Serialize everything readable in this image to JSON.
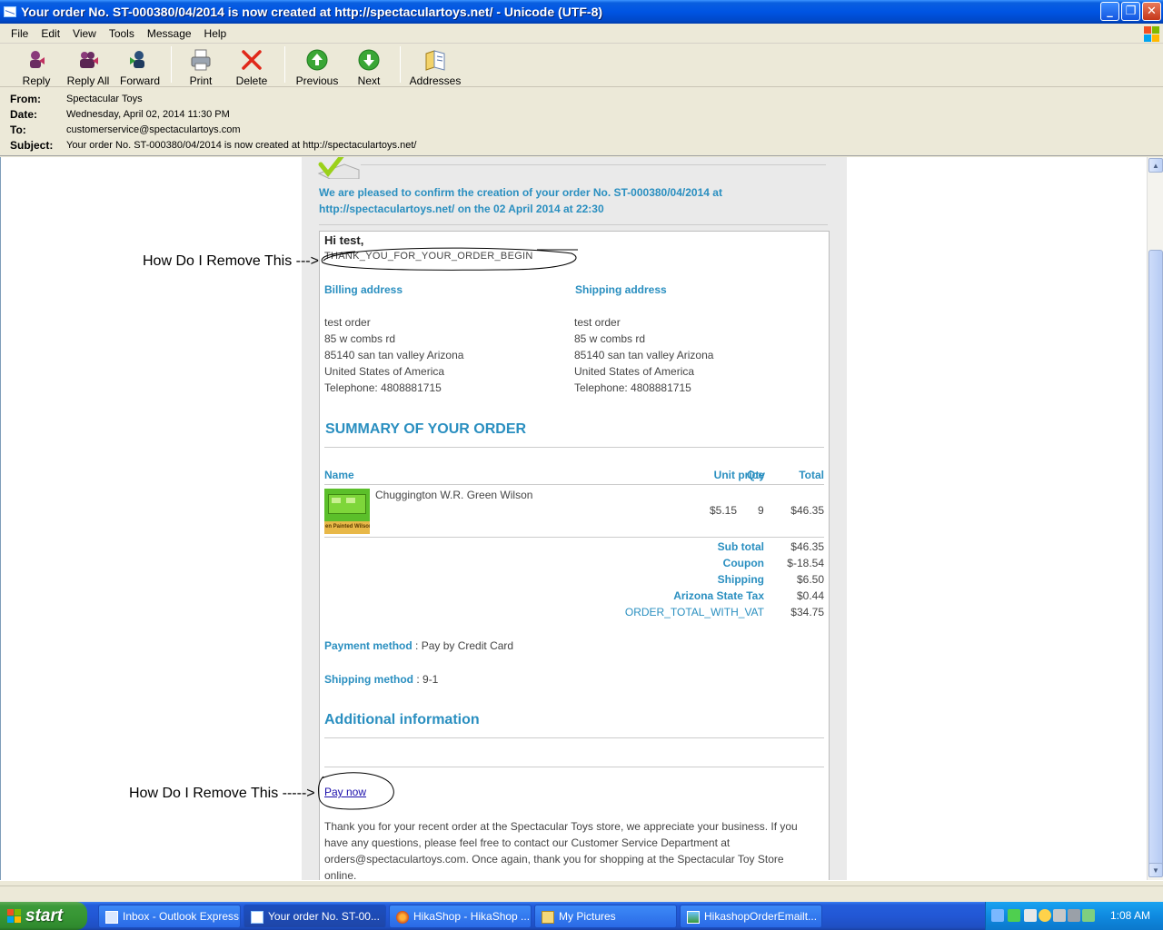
{
  "window": {
    "title": "Your order No. ST-000380/04/2014 is now created at http://spectaculartoys.net/ - Unicode (UTF-8)",
    "min": "_",
    "max": "❐",
    "close": "✕"
  },
  "menu": [
    "File",
    "Edit",
    "View",
    "Tools",
    "Message",
    "Help"
  ],
  "toolbar": {
    "reply": "Reply",
    "reply_all": "Reply All",
    "forward": "Forward",
    "print": "Print",
    "delete": "Delete",
    "previous": "Previous",
    "next": "Next",
    "addresses": "Addresses"
  },
  "header": {
    "from_label": "From:",
    "from": "Spectacular Toys",
    "date_label": "Date:",
    "date": "Wednesday, April 02, 2014 11:30 PM",
    "to_label": "To:",
    "to": "customerservice@spectaculartoys.com",
    "subject_label": "Subject:",
    "subject": "Your order No. ST-000380/04/2014 is now created at http://spectaculartoys.net/"
  },
  "email": {
    "confirm_line1": "We are pleased to confirm the creation of your order No. ST-000380/04/2014 at",
    "confirm_line2": "http://spectaculartoys.net/ on the 02 April 2014 at 22:30",
    "greeting": "Hi test,",
    "thanks_code": "THANK_YOU_FOR_YOUR_ORDER_BEGIN",
    "billing": {
      "title": "Billing address",
      "lines": [
        "test order",
        "85 w combs rd",
        "85140 san tan valley Arizona",
        "United States of America",
        "Telephone: 4808881715"
      ]
    },
    "shipping": {
      "title": "Shipping address",
      "lines": [
        "test order",
        "85 w combs rd",
        "85140 san tan valley Arizona",
        "United States of America",
        "Telephone: 4808881715"
      ]
    },
    "summary_title": "SUMMARY OF YOUR ORDER",
    "table": {
      "name": "Name",
      "unit_price": "Unit price",
      "qty": "Qty",
      "total": "Total"
    },
    "item": {
      "name": "Chuggington W.R. Green Wilson",
      "unit_price": "$5.15",
      "qty": "9",
      "total": "$46.35",
      "image_caption": "en Painted Wilson"
    },
    "totals": {
      "sub_total_label": "Sub total",
      "sub_total": "$46.35",
      "coupon_label": "Coupon",
      "coupon": "$-18.54",
      "shipping_label": "Shipping",
      "shipping": "$6.50",
      "tax_label": "Arizona State Tax",
      "tax": "$0.44",
      "order_total_label": "ORDER_TOTAL_WITH_VAT",
      "order_total": "$34.75"
    },
    "payment_label": "Payment method",
    "payment_value": "Pay by Credit Card",
    "shipping_method_label": "Shipping method",
    "shipping_method_value": "9-1",
    "additional_title": "Additional information",
    "pay_now": "Pay now",
    "footer": "Thank you for your recent order at the Spectacular Toys store, we appreciate your business. If you have any questions, please feel free to contact our Customer Service Department at orders@spectaculartoys.com. Once again, thank you for shopping at the Spectacular Toy Store online."
  },
  "annotations": {
    "first": "How Do I Remove This --->",
    "second": "How Do I Remove This ----->"
  },
  "taskbar": {
    "start": "start",
    "tasks": [
      "Inbox - Outlook Express",
      "Your order No. ST-00...",
      "HikaShop - HikaShop ...",
      "My Pictures",
      "HikashopOrderEmailt..."
    ],
    "clock": "1:08 AM"
  },
  "colors": {
    "accent": "#2a8fc0",
    "link": "#1a0dab",
    "titlebar": "#0054e3",
    "start_green": "#379634"
  }
}
